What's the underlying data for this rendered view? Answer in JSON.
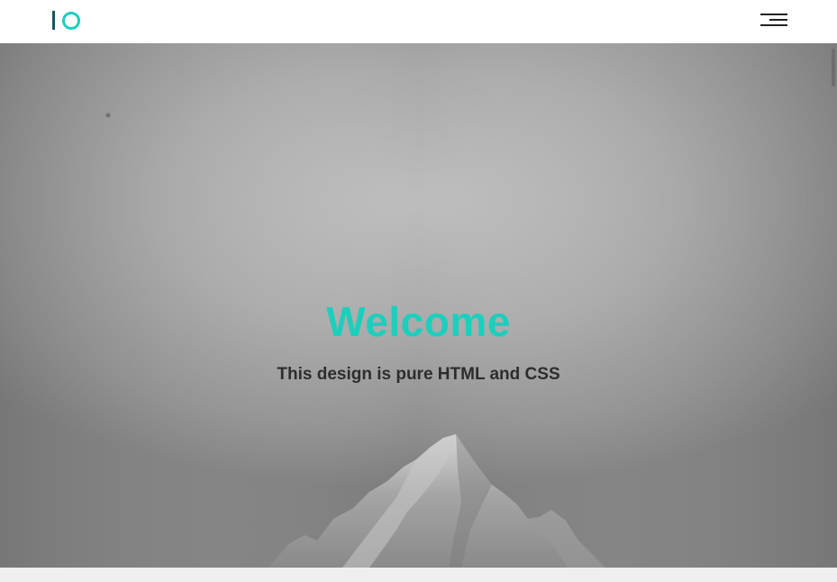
{
  "brand": {
    "logo_icon": "io-logo-icon",
    "colors": {
      "accent": "#1ccfbd",
      "logo_bar": "#14575d",
      "text_dark": "#2d2d2d"
    }
  },
  "header": {
    "menu_icon": "hamburger-menu-icon"
  },
  "hero": {
    "title": "Welcome",
    "subtitle": "This design is pure HTML and CSS"
  }
}
